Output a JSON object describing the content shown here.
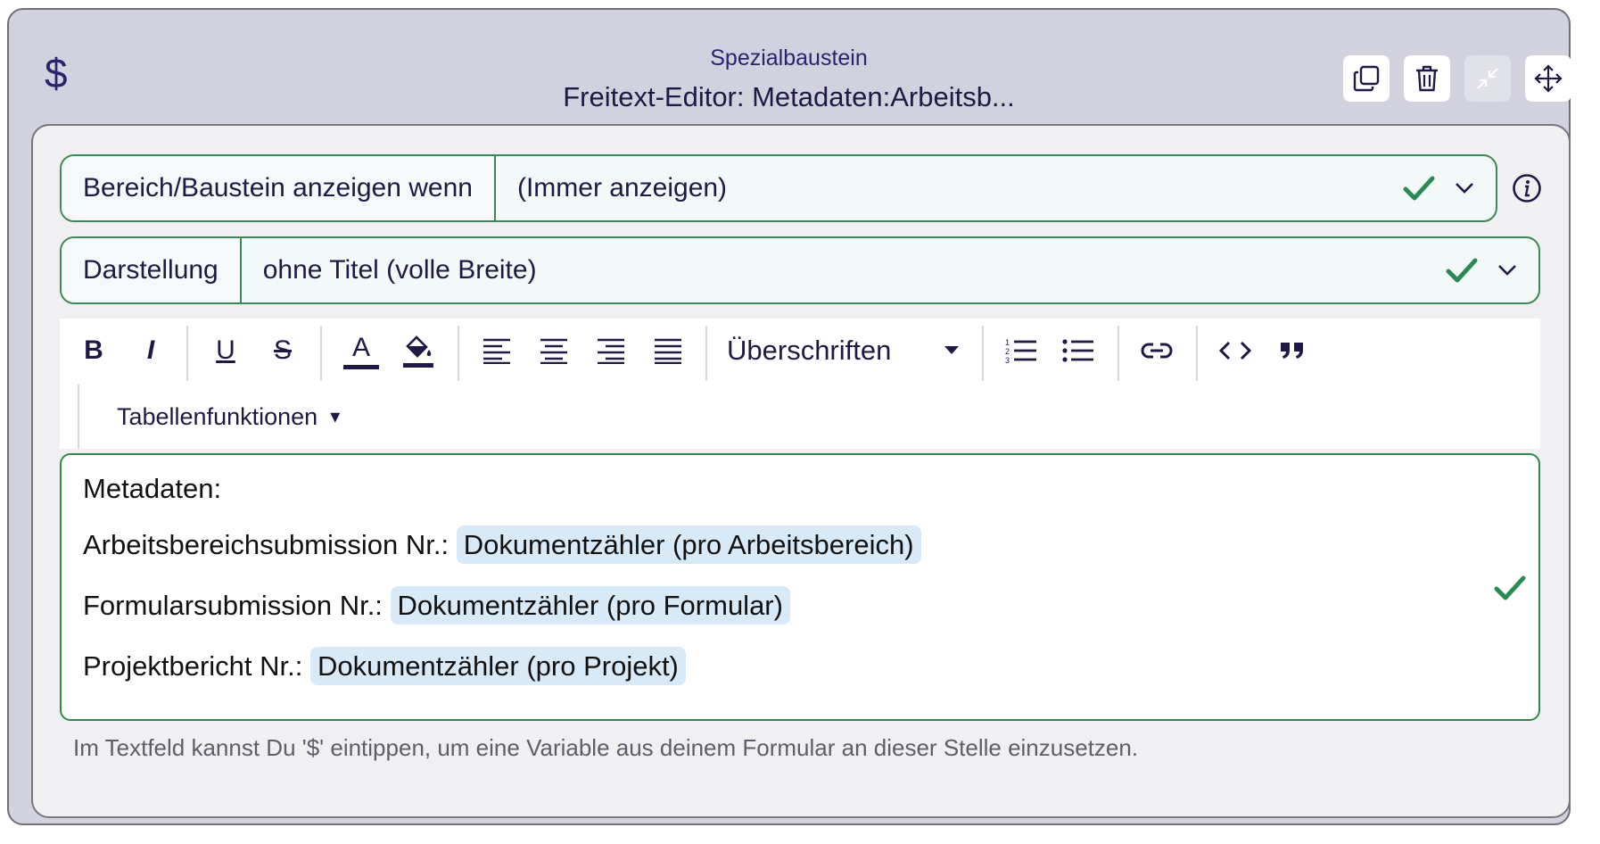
{
  "header": {
    "icon": "dollar-icon",
    "icon_glyph": "$",
    "subtitle": "Spezialbaustein",
    "title": "Freitext-Editor: Metadaten:Arbeitsb...",
    "actions": [
      "copy-icon",
      "trash-icon",
      "collapse-icon",
      "move-icon"
    ]
  },
  "condition_field": {
    "label": "Bereich/Baustein anzeigen wenn",
    "value": "(Immer anzeigen)"
  },
  "display_field": {
    "label": "Darstellung",
    "value": "ohne Titel (volle Breite)"
  },
  "toolbar": {
    "bold": "B",
    "italic": "I",
    "underline": "U",
    "strike": "S",
    "font_color": "A",
    "headings": "Überschriften",
    "table_functions": "Tabellenfunktionen",
    "table_caret": "▾"
  },
  "editor": {
    "heading": "Metadaten:",
    "lines": [
      {
        "label": "Arbeitsbereichsubmission Nr.:",
        "variable": "Dokumentzähler (pro Arbeitsbereich)"
      },
      {
        "label": "Formularsubmission Nr.:",
        "variable": "Dokumentzähler (pro Formular)"
      },
      {
        "label": "Projektbericht Nr.:",
        "variable": "Dokumentzähler (pro Projekt)"
      }
    ]
  },
  "hint": "Im Textfeld kannst Du '$' eintippen, um eine Variable aus deinem Formular an dieser Stelle einzusetzen.",
  "colors": {
    "accent_green": "#2a8a52",
    "text_dark": "#1f1a45",
    "variable_bg": "#d8eaf8",
    "panel_bg": "#d2d2de"
  }
}
